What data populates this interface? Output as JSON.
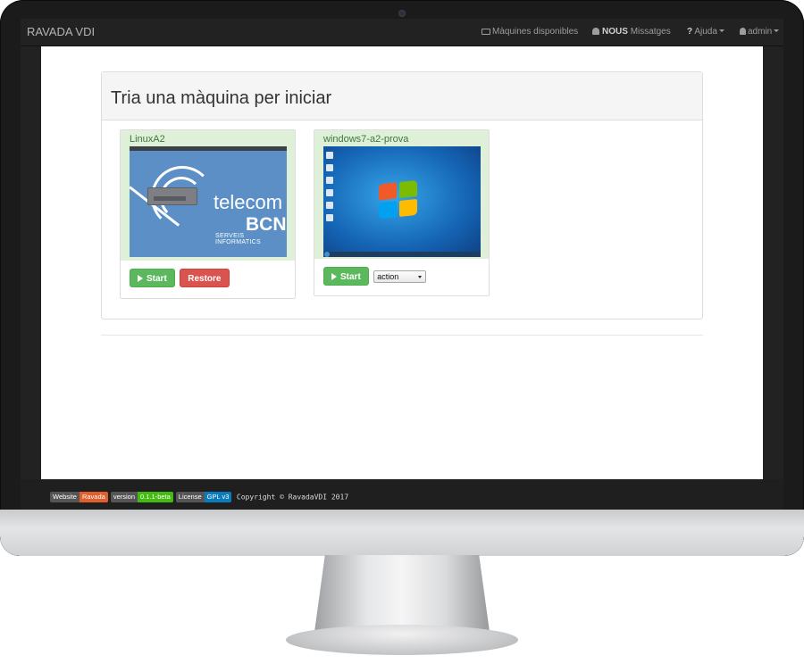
{
  "navbar": {
    "brand": "RAVADA VDI",
    "machines": "Màquines disponibles",
    "messages_count": "NOUS",
    "messages": "Missatges",
    "help": "Ajuda",
    "user": "admin"
  },
  "panel": {
    "title": "Tria una màquina per iniciar"
  },
  "machines": [
    {
      "name": "LinuxA2",
      "start_label": "Start",
      "restore_label": "Restore",
      "screenshot": {
        "word1": "telecom",
        "word2": "BCN",
        "word3": "SERVEIS INFORMATICS"
      }
    },
    {
      "name": "windows7-a2-prova",
      "start_label": "Start",
      "action_selected": "action"
    }
  ],
  "footer": {
    "website_label": "Website",
    "website_value": "Ravada",
    "version_label": "version",
    "version_value": "0.1.1-beta",
    "license_label": "License",
    "license_value": "GPL v3",
    "copyright": "Copyright © RavadaVDI 2017"
  },
  "colors": {
    "success": "#5cb85c",
    "danger": "#d9534f",
    "card_header": "#dff0d8",
    "navbar": "#222222"
  }
}
